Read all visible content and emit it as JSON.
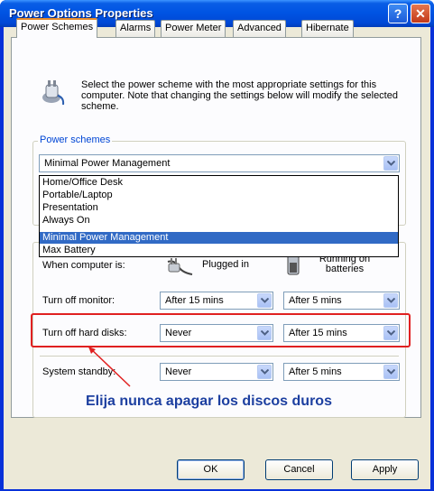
{
  "window": {
    "title": "Power Options Properties",
    "help_glyph": "?",
    "close_glyph": "✕"
  },
  "tabs": [
    "Power Schemes",
    "Alarms",
    "Power Meter",
    "Advanced",
    "Hibernate"
  ],
  "intro_text": "Select the power scheme with the most appropriate settings for this computer. Note that changing the settings below will modify the selected scheme.",
  "power_schemes": {
    "group_label": "Power schemes",
    "selected": "Minimal Power Management",
    "options": [
      "Home/Office Desk",
      "Portable/Laptop",
      "Presentation",
      "Always On",
      "Minimal Power Management",
      "Max Battery"
    ],
    "highlighted_option": "Minimal Power Management"
  },
  "settings": {
    "when_computer_is": "When computer is:",
    "plugged_in": "Plugged in",
    "running_on_batteries": "Running on batteries",
    "rows": [
      {
        "label": "Turn off monitor:",
        "plugged": "After 15 mins",
        "battery": "After 5 mins"
      },
      {
        "label": "Turn off hard disks:",
        "plugged": "Never",
        "battery": "After 15 mins"
      },
      {
        "label": "System standby:",
        "plugged": "Never",
        "battery": "After 5 mins"
      }
    ]
  },
  "annotation": {
    "text": "Elija nunca apagar los discos duros",
    "color": "#1c3fa0",
    "highlight_color": "#e02020"
  },
  "buttons": {
    "ok": "OK",
    "cancel": "Cancel",
    "apply": "Apply"
  },
  "colors": {
    "title_blue": "#0054e3",
    "dialog_bg": "#ece9d8",
    "selection": "#316ac5"
  }
}
